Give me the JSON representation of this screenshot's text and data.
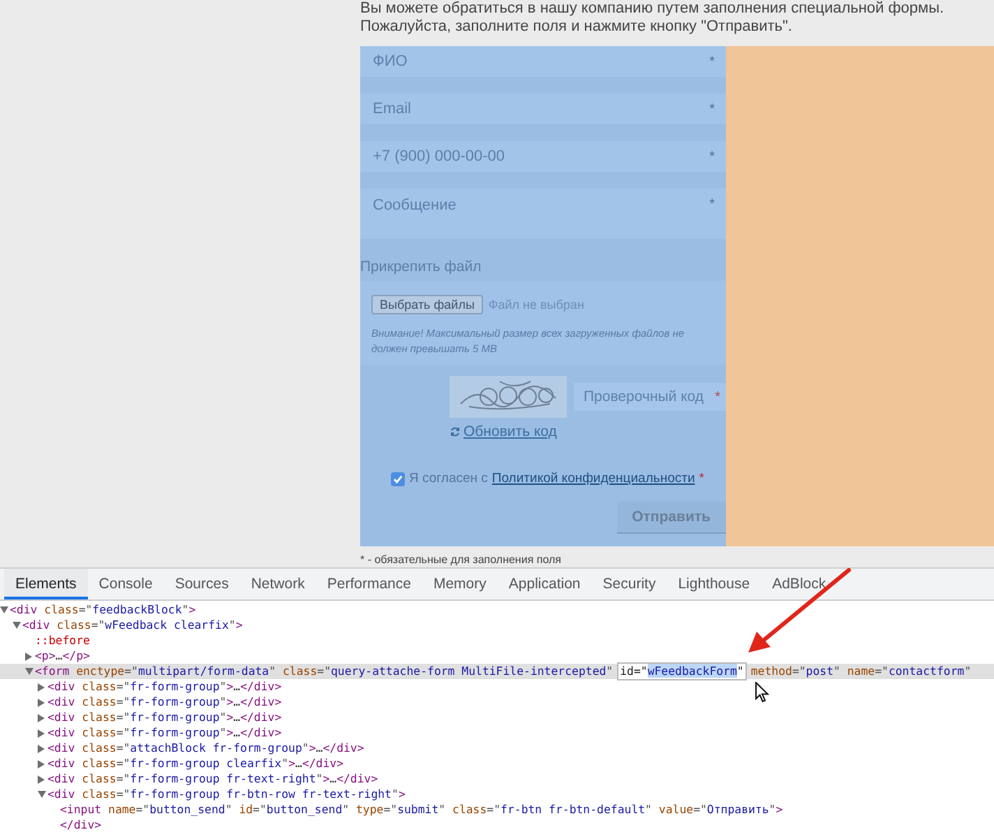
{
  "page": {
    "intro": [
      "Вы можете обратиться в нашу компанию путем заполнения специальной формы.",
      "Пожалуйста, заполните поля и нажмите кнопку \"Отправить\"."
    ],
    "form": {
      "fields": [
        {
          "kind": "input",
          "placeholder": "ФИО",
          "mark": "*"
        },
        {
          "kind": "input",
          "placeholder": "Email",
          "mark": "*"
        },
        {
          "kind": "input",
          "placeholder": "+7 (900) 000-00-00",
          "mark": "*"
        },
        {
          "kind": "textarea",
          "placeholder": "Сообщение",
          "mark": "*"
        }
      ],
      "attach": {
        "label": "Прикрепить файл",
        "button": "Выбрать файлы",
        "status": "Файл не выбран",
        "note": "Внимание! Максимальный размер всех загруженных файлов не должен превышать 5 MB"
      },
      "captcha": {
        "placeholder": "Проверочный код",
        "mark": "*",
        "refresh": "Обновить код"
      },
      "consent": {
        "checked": true,
        "text": "Я согласен с",
        "link": "Политикой конфиденциальности",
        "mark": "*"
      },
      "submit": "Отправить"
    },
    "footnote": "* - обязательные для заполнения поля"
  },
  "devtools": {
    "tabs": [
      {
        "label": "Elements",
        "selected": true
      },
      {
        "label": "Console",
        "selected": false
      },
      {
        "label": "Sources",
        "selected": false
      },
      {
        "label": "Network",
        "selected": false
      },
      {
        "label": "Performance",
        "selected": false
      },
      {
        "label": "Memory",
        "selected": false
      },
      {
        "label": "Application",
        "selected": false
      },
      {
        "label": "Security",
        "selected": false
      },
      {
        "label": "Lighthouse",
        "selected": false
      },
      {
        "label": "AdBlock",
        "selected": false
      }
    ],
    "dom": [
      {
        "expanded": true,
        "selected": false,
        "tokens": [
          {
            "kind": "tag",
            "text": "<div "
          },
          {
            "kind": "attr",
            "text": "class"
          },
          {
            "kind": "punct",
            "text": "=\""
          },
          {
            "kind": "value",
            "text": "feedbackBlock"
          },
          {
            "kind": "punct",
            "text": "\""
          },
          {
            "kind": "tag",
            "text": ">"
          }
        ],
        "children": [
          {
            "expanded": true,
            "selected": false,
            "tokens": [
              {
                "kind": "tag",
                "text": "<div "
              },
              {
                "kind": "attr",
                "text": "class"
              },
              {
                "kind": "punct",
                "text": "=\""
              },
              {
                "kind": "value",
                "text": "wFeedback clearfix"
              },
              {
                "kind": "punct",
                "text": "\""
              },
              {
                "kind": "tag",
                "text": ">"
              }
            ],
            "children": [
              {
                "selected": false,
                "tokens": [
                  {
                    "kind": "pseudo",
                    "text": "::before"
                  }
                ]
              },
              {
                "expanded": false,
                "selected": false,
                "tokens": [
                  {
                    "kind": "tag",
                    "text": "<p>"
                  },
                  {
                    "kind": "text",
                    "text": "…"
                  },
                  {
                    "kind": "tag",
                    "text": "</p>"
                  }
                ]
              },
              {
                "expanded": true,
                "selected": true,
                "tokens": [
                  {
                    "kind": "tag",
                    "text": "<form "
                  },
                  {
                    "kind": "attr",
                    "text": "enctype"
                  },
                  {
                    "kind": "punct",
                    "text": "=\""
                  },
                  {
                    "kind": "value",
                    "text": "multipart/form-data"
                  },
                  {
                    "kind": "punct",
                    "text": "\" "
                  },
                  {
                    "kind": "attr",
                    "text": "class"
                  },
                  {
                    "kind": "punct",
                    "text": "=\""
                  },
                  {
                    "kind": "value",
                    "text": "query-attache-form MultiFile-intercepted"
                  },
                  {
                    "kind": "punct",
                    "text": "\""
                  },
                  {
                    "kind": "edit",
                    "text": "id=\""
                  },
                  {
                    "kind": "edit_sel",
                    "text": "wFeedbackForm"
                  },
                  {
                    "kind": "edit",
                    "text": "\""
                  },
                  {
                    "kind": "attr",
                    "text": "method"
                  },
                  {
                    "kind": "punct",
                    "text": "=\""
                  },
                  {
                    "kind": "value",
                    "text": "post"
                  },
                  {
                    "kind": "punct",
                    "text": "\" "
                  },
                  {
                    "kind": "attr",
                    "text": "name"
                  },
                  {
                    "kind": "punct",
                    "text": "=\""
                  },
                  {
                    "kind": "value",
                    "text": "contactform"
                  },
                  {
                    "kind": "punct",
                    "text": "\""
                  }
                ],
                "children": [
                  {
                    "expanded": false,
                    "selected": false,
                    "tokens": [
                      {
                        "kind": "tag",
                        "text": "<div "
                      },
                      {
                        "kind": "attr",
                        "text": "class"
                      },
                      {
                        "kind": "punct",
                        "text": "=\""
                      },
                      {
                        "kind": "value",
                        "text": "fr-form-group"
                      },
                      {
                        "kind": "punct",
                        "text": "\""
                      },
                      {
                        "kind": "tag",
                        "text": ">"
                      },
                      {
                        "kind": "text",
                        "text": "…"
                      },
                      {
                        "kind": "tag",
                        "text": "</div>"
                      }
                    ]
                  },
                  {
                    "expanded": false,
                    "selected": false,
                    "tokens": [
                      {
                        "kind": "tag",
                        "text": "<div "
                      },
                      {
                        "kind": "attr",
                        "text": "class"
                      },
                      {
                        "kind": "punct",
                        "text": "=\""
                      },
                      {
                        "kind": "value",
                        "text": "fr-form-group"
                      },
                      {
                        "kind": "punct",
                        "text": "\""
                      },
                      {
                        "kind": "tag",
                        "text": ">"
                      },
                      {
                        "kind": "text",
                        "text": "…"
                      },
                      {
                        "kind": "tag",
                        "text": "</div>"
                      }
                    ]
                  },
                  {
                    "expanded": false,
                    "selected": false,
                    "tokens": [
                      {
                        "kind": "tag",
                        "text": "<div "
                      },
                      {
                        "kind": "attr",
                        "text": "class"
                      },
                      {
                        "kind": "punct",
                        "text": "=\""
                      },
                      {
                        "kind": "value",
                        "text": "fr-form-group"
                      },
                      {
                        "kind": "punct",
                        "text": "\""
                      },
                      {
                        "kind": "tag",
                        "text": ">"
                      },
                      {
                        "kind": "text",
                        "text": "…"
                      },
                      {
                        "kind": "tag",
                        "text": "</div>"
                      }
                    ]
                  },
                  {
                    "expanded": false,
                    "selected": false,
                    "tokens": [
                      {
                        "kind": "tag",
                        "text": "<div "
                      },
                      {
                        "kind": "attr",
                        "text": "class"
                      },
                      {
                        "kind": "punct",
                        "text": "=\""
                      },
                      {
                        "kind": "value",
                        "text": "fr-form-group"
                      },
                      {
                        "kind": "punct",
                        "text": "\""
                      },
                      {
                        "kind": "tag",
                        "text": ">"
                      },
                      {
                        "kind": "text",
                        "text": "…"
                      },
                      {
                        "kind": "tag",
                        "text": "</div>"
                      }
                    ]
                  },
                  {
                    "expanded": false,
                    "selected": false,
                    "tokens": [
                      {
                        "kind": "tag",
                        "text": "<div "
                      },
                      {
                        "kind": "attr",
                        "text": "class"
                      },
                      {
                        "kind": "punct",
                        "text": "=\""
                      },
                      {
                        "kind": "value",
                        "text": "attachBlock fr-form-group"
                      },
                      {
                        "kind": "punct",
                        "text": "\""
                      },
                      {
                        "kind": "tag",
                        "text": ">"
                      },
                      {
                        "kind": "text",
                        "text": "…"
                      },
                      {
                        "kind": "tag",
                        "text": "</div>"
                      }
                    ]
                  },
                  {
                    "expanded": false,
                    "selected": false,
                    "tokens": [
                      {
                        "kind": "tag",
                        "text": "<div "
                      },
                      {
                        "kind": "attr",
                        "text": "class"
                      },
                      {
                        "kind": "punct",
                        "text": "=\""
                      },
                      {
                        "kind": "value",
                        "text": "fr-form-group clearfix"
                      },
                      {
                        "kind": "punct",
                        "text": "\""
                      },
                      {
                        "kind": "tag",
                        "text": ">"
                      },
                      {
                        "kind": "text",
                        "text": "…"
                      },
                      {
                        "kind": "tag",
                        "text": "</div>"
                      }
                    ]
                  },
                  {
                    "expanded": false,
                    "selected": false,
                    "tokens": [
                      {
                        "kind": "tag",
                        "text": "<div "
                      },
                      {
                        "kind": "attr",
                        "text": "class"
                      },
                      {
                        "kind": "punct",
                        "text": "=\""
                      },
                      {
                        "kind": "value",
                        "text": "fr-form-group fr-text-right"
                      },
                      {
                        "kind": "punct",
                        "text": "\""
                      },
                      {
                        "kind": "tag",
                        "text": ">"
                      },
                      {
                        "kind": "text",
                        "text": "…"
                      },
                      {
                        "kind": "tag",
                        "text": "</div>"
                      }
                    ]
                  },
                  {
                    "expanded": true,
                    "selected": false,
                    "tokens": [
                      {
                        "kind": "tag",
                        "text": "<div "
                      },
                      {
                        "kind": "attr",
                        "text": "class"
                      },
                      {
                        "kind": "punct",
                        "text": "=\""
                      },
                      {
                        "kind": "value",
                        "text": "fr-form-group fr-btn-row fr-text-right"
                      },
                      {
                        "kind": "punct",
                        "text": "\""
                      },
                      {
                        "kind": "tag",
                        "text": ">"
                      }
                    ],
                    "closing": [
                      {
                        "kind": "tag",
                        "text": "</div>"
                      }
                    ],
                    "children": [
                      {
                        "selected": false,
                        "tokens": [
                          {
                            "kind": "tag",
                            "text": "<input "
                          },
                          {
                            "kind": "attr",
                            "text": "name"
                          },
                          {
                            "kind": "punct",
                            "text": "=\""
                          },
                          {
                            "kind": "value",
                            "text": "button_send"
                          },
                          {
                            "kind": "punct",
                            "text": "\" "
                          },
                          {
                            "kind": "attr",
                            "text": "id"
                          },
                          {
                            "kind": "punct",
                            "text": "=\""
                          },
                          {
                            "kind": "value",
                            "text": "button_send"
                          },
                          {
                            "kind": "punct",
                            "text": "\" "
                          },
                          {
                            "kind": "attr",
                            "text": "type"
                          },
                          {
                            "kind": "punct",
                            "text": "=\""
                          },
                          {
                            "kind": "value",
                            "text": "submit"
                          },
                          {
                            "kind": "punct",
                            "text": "\" "
                          },
                          {
                            "kind": "attr",
                            "text": "class"
                          },
                          {
                            "kind": "punct",
                            "text": "=\""
                          },
                          {
                            "kind": "value",
                            "text": "fr-btn fr-btn-default"
                          },
                          {
                            "kind": "punct",
                            "text": "\" "
                          },
                          {
                            "kind": "attr",
                            "text": "value"
                          },
                          {
                            "kind": "punct",
                            "text": "=\""
                          },
                          {
                            "kind": "value",
                            "text": "Отправить"
                          },
                          {
                            "kind": "punct",
                            "text": "\""
                          },
                          {
                            "kind": "tag",
                            "text": ">"
                          }
                        ]
                      }
                    ]
                  }
                ]
              }
            ]
          }
        ]
      }
    ]
  }
}
